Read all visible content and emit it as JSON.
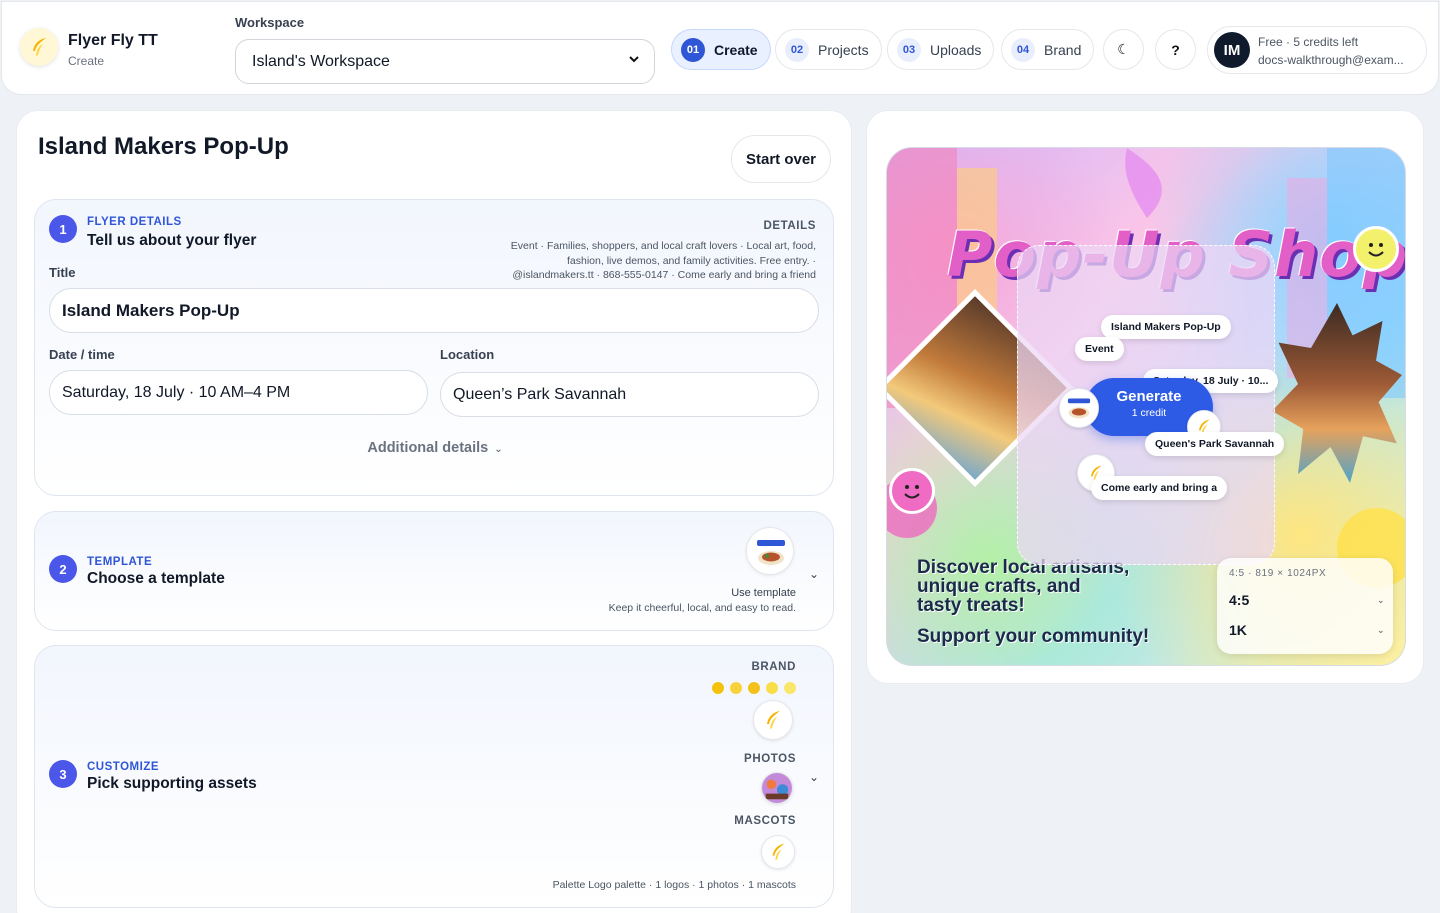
{
  "header": {
    "app_name": "Flyer Fly TT",
    "app_section": "Create",
    "workspace_label": "Workspace",
    "workspace_value": "Island's Workspace",
    "nav": [
      {
        "num": "01",
        "label": "Create",
        "active": true
      },
      {
        "num": "02",
        "label": "Projects"
      },
      {
        "num": "03",
        "label": "Uploads"
      },
      {
        "num": "04",
        "label": "Brand"
      }
    ],
    "theme_icon": "☾",
    "help_icon": "?",
    "account": {
      "initials": "IM",
      "plan": "Free · 5 credits left",
      "email": "docs-walkthrough@exam..."
    }
  },
  "editor": {
    "title": "Island Makers Pop-Up",
    "start_over": "Start over",
    "flyer_details": {
      "step": "1",
      "kicker": "FLYER DETAILS",
      "title": "Tell us about your flyer",
      "details_head": "DETAILS",
      "details_text": "Event · Families, shoppers, and local craft lovers · Local art, food, fashion, live demos, and family activities. Free entry. · @islandmakers.tt · 868-555-0147 · Come early and bring a friend",
      "title_label": "Title",
      "title_value": "Island Makers Pop-Up",
      "date_label": "Date / time",
      "date_value": "Saturday, 18 July · 10 AM–4 PM",
      "location_label": "Location",
      "location_value": "Queen’s Park Savannah",
      "additional": "Additional details",
      "additional_chev": "⌄"
    },
    "template": {
      "step": "2",
      "kicker": "TEMPLATE",
      "title": "Choose a template",
      "use_label": "Use template",
      "note": "Keep it cheerful, local, and easy to read.",
      "chev": "⌄"
    },
    "customize": {
      "step": "3",
      "kicker": "CUSTOMIZE",
      "title": "Pick supporting assets",
      "brand_head": "BRAND",
      "photos_head": "PHOTOS",
      "mascots_head": "MASCOTS",
      "swatches": [
        "#f4c20d",
        "#f7d23a",
        "#f2c21a",
        "#f8df4a",
        "#f9e66b"
      ],
      "summary": "Palette Logo palette · 1 logos · 1 photos · 1 mascots",
      "chev": "⌄"
    }
  },
  "preview": {
    "headline": "Pop-Up Shop",
    "tagline_lines": [
      "Discover local artisans,",
      "unique crafts, and",
      "tasty treats!"
    ],
    "subline": "Support your community!",
    "chips": {
      "title": "Island Makers Pop-Up",
      "type": "Event",
      "date": "Saturday, 18 July · 10...",
      "location": "Queen's Park Savannah",
      "cta": "Come early and bring a"
    },
    "generate_label": "Generate",
    "generate_cost": "1 credit",
    "ratio_head": "4:5 · 819 × 1024PX",
    "ratio_value": "4:5",
    "size_value": "1K",
    "chev": "⌄"
  }
}
